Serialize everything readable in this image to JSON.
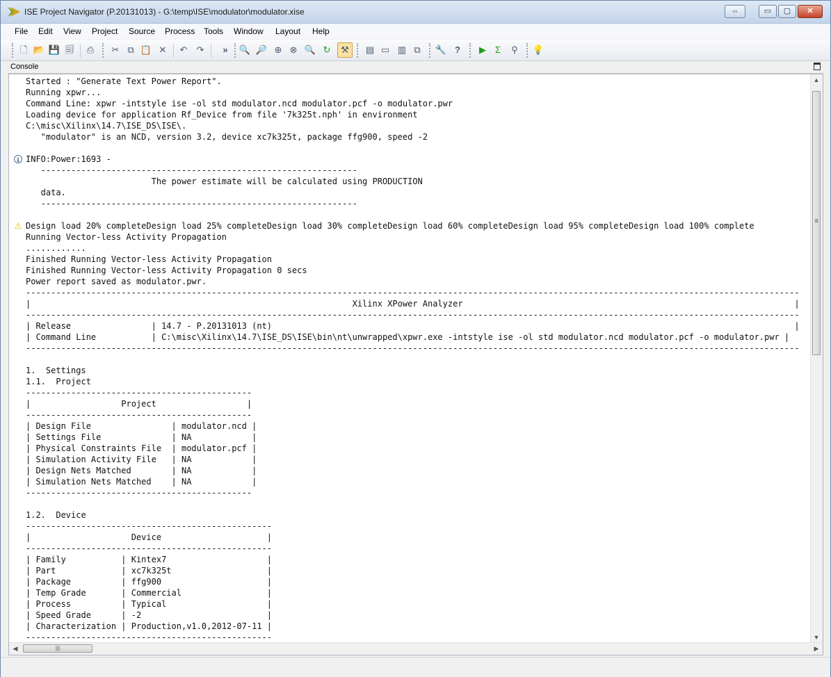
{
  "window": {
    "title": "ISE Project Navigator (P.20131013) - G:\\temp\\ISE\\modulator\\modulator.xise"
  },
  "caption_buttons": {
    "restore_glyph": "⇔",
    "minimize_glyph": "▭",
    "maximize_glyph": "▢",
    "close_glyph": "✕"
  },
  "menu": [
    "File",
    "Edit",
    "View",
    "Project",
    "Source",
    "Process",
    "Tools",
    "Window",
    "Layout",
    "Help"
  ],
  "toolbar": [
    {
      "name": "new-file-icon",
      "glyph": "🗋"
    },
    {
      "name": "open-folder-icon",
      "glyph": "📂"
    },
    {
      "name": "save-icon",
      "glyph": "💾"
    },
    {
      "name": "save-all-icon",
      "glyph": "🗐"
    },
    {
      "name": "print-icon",
      "glyph": "⎙"
    },
    {
      "name": "cut-icon",
      "glyph": "✂"
    },
    {
      "name": "copy-icon",
      "glyph": "⧉"
    },
    {
      "name": "paste-icon",
      "glyph": "📋"
    },
    {
      "name": "delete-icon",
      "glyph": "✕"
    },
    {
      "name": "undo-icon",
      "glyph": "↶"
    },
    {
      "name": "redo-icon",
      "glyph": "↷"
    },
    {
      "name": "overflow-icon",
      "glyph": "»"
    },
    {
      "name": "zoom-in-icon",
      "glyph": "🔍"
    },
    {
      "name": "zoom-out-icon",
      "glyph": "🔎"
    },
    {
      "name": "zoom-full-icon",
      "glyph": "⊕"
    },
    {
      "name": "zoom-select-icon",
      "glyph": "⊗"
    },
    {
      "name": "find-icon",
      "glyph": "🔍"
    },
    {
      "name": "refresh-icon",
      "glyph": "↻"
    },
    {
      "name": "design-tools-icon",
      "glyph": "⚒"
    },
    {
      "name": "cascade-windows-icon",
      "glyph": "▤"
    },
    {
      "name": "tile-horizontal-icon",
      "glyph": "▭"
    },
    {
      "name": "tile-vertical-icon",
      "glyph": "▥"
    },
    {
      "name": "float-window-icon",
      "glyph": "⧉"
    },
    {
      "name": "tools-wrench-icon",
      "glyph": "🔧"
    },
    {
      "name": "help-context-icon",
      "glyph": "?"
    },
    {
      "name": "run-icon",
      "glyph": "▶"
    },
    {
      "name": "sum-icon",
      "glyph": "Σ"
    },
    {
      "name": "pin-icon",
      "glyph": "⚲"
    },
    {
      "name": "lightbulb-icon",
      "glyph": "💡"
    }
  ],
  "panel": {
    "title": "Console"
  },
  "console": {
    "lines": [
      "Started : \"Generate Text Power Report\".",
      "Running xpwr...",
      "Command Line: xpwr -intstyle ise -ol std modulator.ncd modulator.pcf -o modulator.pwr",
      "Loading device for application Rf_Device from file '7k325t.nph' in environment",
      "C:\\misc\\Xilinx\\14.7\\ISE_DS\\ISE\\.",
      "   \"modulator\" is an NCD, version 3.2, device xc7k325t, package ffg900, speed -2",
      "",
      "INFO:Power:1693 -",
      "   ---------------------------------------------------------------",
      "                         The power estimate will be calculated using PRODUCTION",
      "   data.",
      "   ---------------------------------------------------------------",
      "",
      "Design load 20% completeDesign load 25% completeDesign load 30% completeDesign load 60% completeDesign load 95% completeDesign load 100% complete",
      "Running Vector-less Activity Propagation",
      "............",
      "Finished Running Vector-less Activity Propagation",
      "Finished Running Vector-less Activity Propagation 0 secs",
      "Power report saved as modulator.pwr.",
      "----------------------------------------------------------------------------------------------------------------------------------------------------------",
      "|                                                                Xilinx XPower Analyzer                                                                  |",
      "----------------------------------------------------------------------------------------------------------------------------------------------------------",
      "| Release                | 14.7 - P.20131013 (nt)                                                                                                        |",
      "| Command Line           | C:\\misc\\Xilinx\\14.7\\ISE_DS\\ISE\\bin\\nt\\unwrapped\\xpwr.exe -intstyle ise -ol std modulator.ncd modulator.pcf -o modulator.pwr |",
      "----------------------------------------------------------------------------------------------------------------------------------------------------------",
      "",
      "1.  Settings",
      "1.1.  Project",
      "---------------------------------------------",
      "|                  Project                  |",
      "---------------------------------------------",
      "| Design File                | modulator.ncd |",
      "| Settings File              | NA            |",
      "| Physical Constraints File  | modulator.pcf |",
      "| Simulation Activity File   | NA            |",
      "| Design Nets Matched        | NA            |",
      "| Simulation Nets Matched    | NA            |",
      "---------------------------------------------",
      "",
      "1.2.  Device",
      "-------------------------------------------------",
      "|                    Device                     |",
      "-------------------------------------------------",
      "| Family           | Kintex7                    |",
      "| Part             | xc7k325t                   |",
      "| Package          | ffg900                     |",
      "| Temp Grade       | Commercial                 |",
      "| Process          | Typical                    |",
      "| Speed Grade      | -2                         |",
      "| Characterization | Production,v1.0,2012-07-11 |",
      "-------------------------------------------------"
    ],
    "markers": [
      {
        "line": 7,
        "type": "info",
        "glyph": "i"
      },
      {
        "line": 13,
        "type": "warning",
        "glyph": "⚠"
      }
    ]
  },
  "scrollbars": {
    "up_glyph": "▲",
    "down_glyph": "▼",
    "left_glyph": "◀",
    "right_glyph": "▶",
    "grip_glyph": "|||",
    "v_grip_glyph": "≡"
  }
}
